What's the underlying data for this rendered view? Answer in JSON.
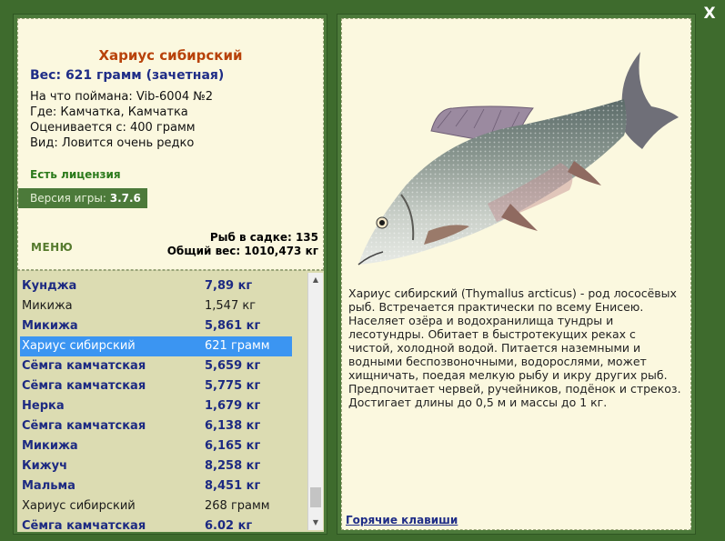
{
  "close_label": "X",
  "fish": {
    "name": "Хариус сибирский",
    "weight": "Вес: 621 грамм (зачетная)",
    "caught_on": "На что поймана: Vib-6004 №2",
    "location": "Где: Камчатка, Камчатка",
    "valued_from": "Оценивается с: 400 грамм",
    "rarity": "Вид: Ловится очень редко"
  },
  "license": "Есть лицензия",
  "version": {
    "label": "Версия игры:",
    "value": "3.7.6"
  },
  "menu_label": "МЕНЮ",
  "stats": {
    "fish_count": "Рыб в садке: 135",
    "total_weight": "Общий вес: 1010,473 кг"
  },
  "catch_list": [
    {
      "name": "Кунджа",
      "weight": "7,89 кг",
      "style": "bold"
    },
    {
      "name": "Микижа",
      "weight": "1,547 кг",
      "style": "normal"
    },
    {
      "name": "Микижа",
      "weight": "5,861 кг",
      "style": "bold"
    },
    {
      "name": "Хариус сибирский",
      "weight": "621 грамм",
      "style": "selected"
    },
    {
      "name": "Сёмга камчатская",
      "weight": "5,659 кг",
      "style": "bold"
    },
    {
      "name": "Сёмга камчатская",
      "weight": "5,775 кг",
      "style": "bold"
    },
    {
      "name": "Нерка",
      "weight": "1,679 кг",
      "style": "bold"
    },
    {
      "name": "Сёмга камчатская",
      "weight": "6,138 кг",
      "style": "bold"
    },
    {
      "name": "Микижа",
      "weight": "6,165 кг",
      "style": "bold"
    },
    {
      "name": "Кижуч",
      "weight": "8,258 кг",
      "style": "bold"
    },
    {
      "name": "Мальма",
      "weight": "8,451 кг",
      "style": "bold"
    },
    {
      "name": "Хариус сибирский",
      "weight": "268 грамм",
      "style": "normal"
    },
    {
      "name": "Сёмга камчатская",
      "weight": "6.02 кг",
      "style": "bold"
    }
  ],
  "description": "Хариус сибирский (Thymallus arcticus) - род лососёвых рыб. Встречается практически по всему Енисею. Населяет озёра и водохранилища тундры и лесотундры. Обитает в быстротекущих реках с чистой, холодной водой. Питается наземными и водными беспозвоночными, водорослями, может хищничать, поедая мелкую рыбу и икру других рыб. Предпочитает червей, ручейников, подёнок и стрекоз. Достигает длины до 0,5 м и массы до 1 кг.",
  "hotkeys_label": "Горячие клавиши",
  "colors": {
    "background": "#3e6b2d",
    "panel_cream": "#fbf8df",
    "list_bg": "#dcdcb2",
    "selection": "#3b95f2",
    "title_orange": "#b8420a",
    "navy": "#1f2d87",
    "license_green": "#2b7a1b"
  }
}
